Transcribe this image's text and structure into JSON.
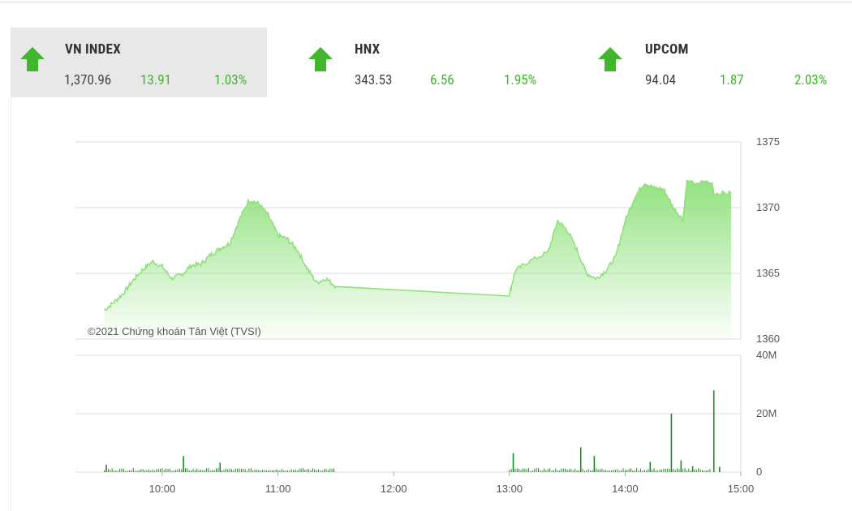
{
  "indices": [
    {
      "name": "VN INDEX",
      "value": "1,370.96",
      "change": "13.91",
      "percent": "1.03%",
      "direction": "up-arrow-icon",
      "active": true
    },
    {
      "name": "HNX",
      "value": "343.53",
      "change": "6.56",
      "percent": "1.95%",
      "direction": "up-arrow-icon",
      "active": false
    },
    {
      "name": "UPCOM",
      "value": "94.04",
      "change": "1.87",
      "percent": "2.03%",
      "direction": "up-arrow-icon",
      "active": false
    }
  ],
  "colors": {
    "up": "#3fb62b",
    "line": "#8de07a",
    "volume": "#1f8a1f",
    "active_tab": "#e8e8e8"
  },
  "copyright": "©2021 Chứng khoán Tân Việt (TVSI)",
  "chart_data": [
    {
      "type": "area",
      "series_name": "VN INDEX",
      "ylim": [
        1360,
        1375
      ],
      "yticks": [
        "1375",
        "1370",
        "1365",
        "1360"
      ],
      "xticks": [
        "10:00",
        "11:00",
        "12:00",
        "13:00",
        "14:00",
        "15:00"
      ],
      "points": [
        [
          "09:30",
          1362.2
        ],
        [
          "09:35",
          1362.8
        ],
        [
          "09:40",
          1363.5
        ],
        [
          "09:45",
          1364.5
        ],
        [
          "09:50",
          1365.3
        ],
        [
          "09:55",
          1365.9
        ],
        [
          "10:00",
          1365.5
        ],
        [
          "10:05",
          1364.6
        ],
        [
          "10:10",
          1364.9
        ],
        [
          "10:15",
          1365.6
        ],
        [
          "10:20",
          1365.7
        ],
        [
          "10:25",
          1366.4
        ],
        [
          "10:30",
          1366.9
        ],
        [
          "10:35",
          1367.3
        ],
        [
          "10:40",
          1369.1
        ],
        [
          "10:45",
          1370.6
        ],
        [
          "10:50",
          1370.3
        ],
        [
          "10:55",
          1369.4
        ],
        [
          "11:00",
          1367.9
        ],
        [
          "11:05",
          1367.6
        ],
        [
          "11:10",
          1366.8
        ],
        [
          "11:15",
          1365.4
        ],
        [
          "11:20",
          1364.3
        ],
        [
          "11:25",
          1364.6
        ],
        [
          "11:30",
          1364.0
        ],
        [
          "13:00",
          1363.4
        ],
        [
          "13:03",
          1365.2
        ],
        [
          "13:10",
          1365.9
        ],
        [
          "13:20",
          1366.6
        ],
        [
          "13:25",
          1369.0
        ],
        [
          "13:30",
          1368.3
        ],
        [
          "13:35",
          1366.8
        ],
        [
          "13:40",
          1365.0
        ],
        [
          "13:45",
          1364.6
        ],
        [
          "13:50",
          1365.2
        ],
        [
          "13:55",
          1366.2
        ],
        [
          "14:00",
          1369.0
        ],
        [
          "14:05",
          1370.8
        ],
        [
          "14:10",
          1371.9
        ],
        [
          "14:15",
          1371.5
        ],
        [
          "14:20",
          1371.4
        ],
        [
          "14:25",
          1370.0
        ],
        [
          "14:30",
          1369.1
        ],
        [
          "14:32",
          1371.9
        ],
        [
          "14:45",
          1371.9
        ],
        [
          "14:46",
          1371.1
        ],
        [
          "14:55",
          1371.1
        ]
      ]
    },
    {
      "type": "bar",
      "series_name": "Volume",
      "ylim": [
        0,
        40
      ],
      "yticks": [
        "40M",
        "20M",
        "0"
      ],
      "xticks": [
        "10:00",
        "11:00",
        "12:00",
        "13:00",
        "14:00",
        "15:00"
      ],
      "spikes": [
        [
          "09:31",
          2.5
        ],
        [
          "10:11",
          5.5
        ],
        [
          "10:30",
          3.2
        ],
        [
          "13:02",
          6.5
        ],
        [
          "13:37",
          8.5
        ],
        [
          "13:44",
          5.5
        ],
        [
          "14:13",
          3.5
        ],
        [
          "14:24",
          20.0
        ],
        [
          "14:29",
          4.0
        ],
        [
          "14:35",
          2.0
        ],
        [
          "14:46",
          28.0
        ],
        [
          "14:49",
          1.8
        ]
      ]
    }
  ]
}
